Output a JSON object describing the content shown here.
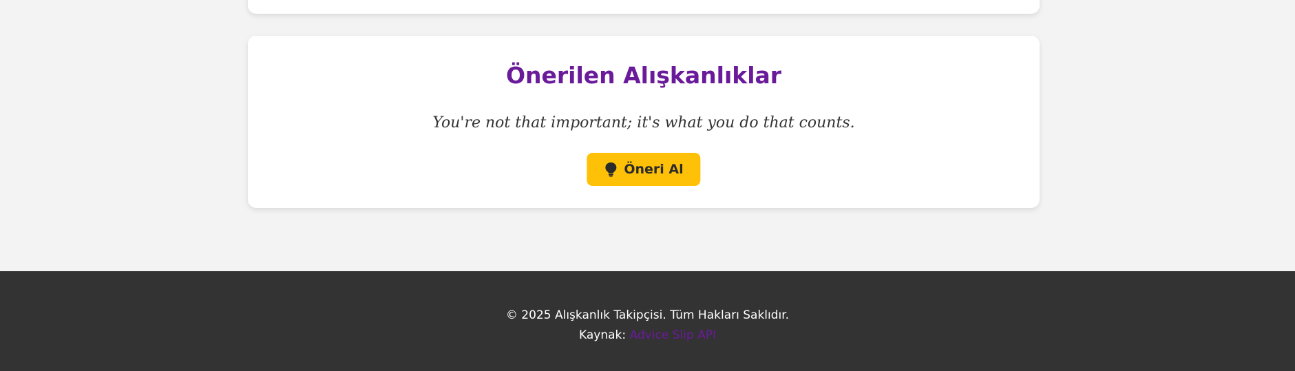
{
  "suggestions": {
    "title": "Önerilen Alışkanlıklar",
    "quote": "You're not that important; it's what you do that counts.",
    "button_label": "Öneri Al",
    "button_icon": "lightbulb-icon",
    "accent_color": "#6a1b9a",
    "button_color": "#ffc107"
  },
  "footer": {
    "copyright": "© 2025 Alışkanlık Takipçisi. Tüm Hakları Saklıdır.",
    "source_prefix": "Kaynak:",
    "source_link_label": "Advice Slip API",
    "background_color": "#333333"
  }
}
